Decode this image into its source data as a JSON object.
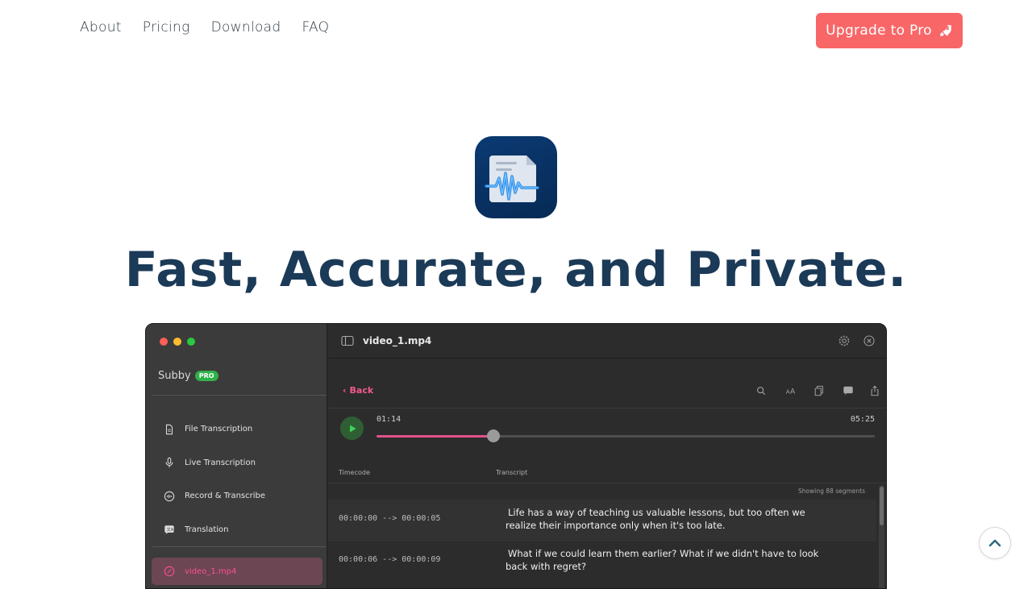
{
  "nav": {
    "links": [
      "About",
      "Pricing",
      "Download",
      "FAQ"
    ],
    "upgrade_label": "Upgrade to Pro",
    "upgrade_icon": "rocket-icon",
    "accent_color": "#f86667"
  },
  "hero": {
    "logo_icon": "transcript-waveform-icon",
    "headline": "Fast, Accurate, and Private."
  },
  "app_window": {
    "sidebar": {
      "app_name": "Subby",
      "badge": "PRO",
      "items": [
        {
          "label": "File Transcription",
          "icon": "document-icon"
        },
        {
          "label": "Live Transcription",
          "icon": "microphone-icon"
        },
        {
          "label": "Record & Transcribe",
          "icon": "record-waveform-icon"
        },
        {
          "label": "Translation",
          "icon": "translate-icon"
        }
      ],
      "recent_file": {
        "label": "video_1.mp4",
        "icon": "waveform-icon"
      }
    },
    "main": {
      "title": "video_1.mp4",
      "back_label": "Back",
      "player": {
        "current_time": "01:14",
        "total_time": "05:25",
        "progress": 0.235
      },
      "columns": {
        "timecode": "Timecode",
        "transcript": "Transcript"
      },
      "segment_count": "Showing 88 segments",
      "rows": [
        {
          "timecode": "00:00:00 --> 00:00:05",
          "text": "Life has a way of teaching us valuable lessons, but too often we realize their importance only when it's too late."
        },
        {
          "timecode": "00:00:06 --> 00:00:09",
          "text": "What if we could learn them earlier? What if we didn't have to look back with regret?"
        }
      ]
    }
  }
}
